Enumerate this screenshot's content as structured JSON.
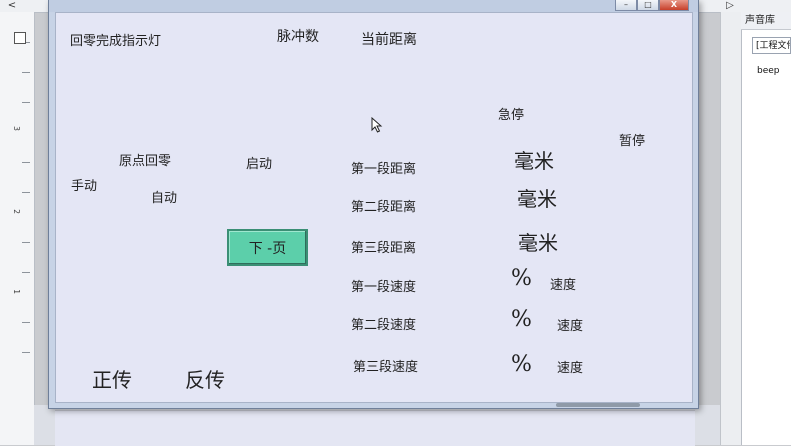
{
  "ide": {
    "left_arrow": "<",
    "right_arrow": "▷",
    "ruler_numbers": [
      "3",
      "2",
      "1"
    ],
    "right_panel_title": "声音库",
    "right_panel_field": "[工程文件",
    "right_panel_item": "beep"
  },
  "window": {
    "buttons": {
      "minimize": "–",
      "maximize": "□",
      "close": "X"
    }
  },
  "labels": {
    "homing_done_light": "回零完成指示灯",
    "pulse_count": "脉冲数",
    "current_distance": "当前距离",
    "emergency_stop": "急停",
    "pause": "暂停",
    "origin_homing": "原点回零",
    "start": "启动",
    "manual": "手动",
    "auto": "自动",
    "seg1_distance": "第一段距离",
    "seg2_distance": "第二段距离",
    "seg3_distance": "第三段距离",
    "seg1_speed": "第一段速度",
    "seg2_speed": "第二段速度",
    "seg3_speed": "第三段速度",
    "mm1": "毫米",
    "mm2": "毫米",
    "mm3": "毫米",
    "pct1": "%",
    "pct2": "%",
    "pct3": "%",
    "speed1": "速度",
    "speed2": "速度",
    "speed3": "速度",
    "forward": "正传",
    "reverse": "反传"
  },
  "next_page_button": "下 -页"
}
